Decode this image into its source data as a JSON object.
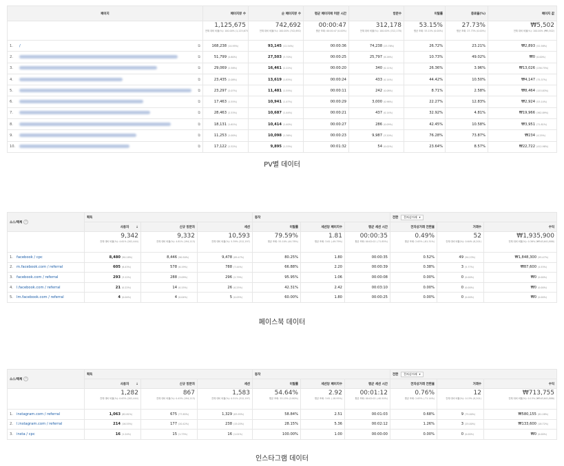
{
  "pv": {
    "caption": "PV별 데이터",
    "headers": [
      "페이지",
      "페이지뷰 수",
      "순 페이지뷰 수",
      "평균 페이지에 머문 시간",
      "방문수",
      "이탈률",
      "종료율(%)",
      "페이지 값"
    ],
    "totals": [
      {
        "big": "1,125,675",
        "sub": "전체 대비 비율(%): 100.00% (1,125,675)"
      },
      {
        "big": "742,692",
        "sub": "전체 대비 비율(%): 100.00% (742,692)"
      },
      {
        "big": "00:00:47",
        "sub": "평균 조회: 00:00:47 (0.00%)"
      },
      {
        "big": "312,178",
        "sub": "전체 대비 비율(%): 100.00% (312,178)"
      },
      {
        "big": "53.15%",
        "sub": "평균 조회: 53.15% (0.00%)"
      },
      {
        "big": "27.73%",
        "sub": "평균 조회: 27.73% (0.00%)"
      },
      {
        "big": "₩5,502",
        "sub": "전체 대비 비율(%): 100.00% (₩5,502)"
      }
    ],
    "rows": [
      {
        "n": "1.",
        "page": "/",
        "pv": "168,238",
        "pvp": "(14.95%)",
        "upv": "93,145",
        "upvp": "(12.54%)",
        "time": "00:00:36",
        "ent": "74,238",
        "entp": "(23.78%)",
        "bounce": "26.72%",
        "exit": "23.21%",
        "val": "₩2,893",
        "valp": "(52.58%)"
      },
      {
        "n": "2.",
        "page": "",
        "pv": "51,799",
        "pvp": "(4.60%)",
        "upv": "27,503",
        "upvp": "(3.70%)",
        "time": "00:00:25",
        "ent": "25,797",
        "entp": "(8.26%)",
        "bounce": "10.73%",
        "exit": "49.02%",
        "val": "₩0",
        "valp": "(0.00%)"
      },
      {
        "n": "3.",
        "page": "",
        "pv": "29,069",
        "pvp": "(2.58%)",
        "upv": "16,461",
        "upvp": "(2.22%)",
        "time": "00:00:20",
        "ent": "340",
        "entp": "(0.11%)",
        "bounce": "26.36%",
        "exit": "3.96%",
        "val": "₩13,026",
        "valp": "(236.75%)"
      },
      {
        "n": "4.",
        "page": "",
        "pv": "23,435",
        "pvp": "(2.08%)",
        "upv": "13,619",
        "upvp": "(1.83%)",
        "time": "00:00:24",
        "ent": "433",
        "entp": "(0.14%)",
        "bounce": "44.42%",
        "exit": "10.50%",
        "val": "₩4,147",
        "valp": "(75.37%)"
      },
      {
        "n": "5.",
        "page": "",
        "pv": "23,297",
        "pvp": "(2.07%)",
        "upv": "11,481",
        "upvp": "(1.55%)",
        "time": "00:00:11",
        "ent": "242",
        "entp": "(0.08%)",
        "bounce": "8.71%",
        "exit": "2.58%",
        "val": "₩8,464",
        "valp": "(153.83%)"
      },
      {
        "n": "6.",
        "page": "",
        "pv": "17,463",
        "pvp": "(1.55%)",
        "upv": "10,941",
        "upvp": "(1.47%)",
        "time": "00:00:29",
        "ent": "3,000",
        "entp": "(0.96%)",
        "bounce": "22.27%",
        "exit": "12.83%",
        "val": "₩2,924",
        "valp": "(53.14%)"
      },
      {
        "n": "7.",
        "page": "",
        "pv": "28,463",
        "pvp": "(2.53%)",
        "upv": "10,687",
        "upvp": "(1.44%)",
        "time": "00:00:21",
        "ent": "437",
        "entp": "(0.14%)",
        "bounce": "32.92%",
        "exit": "4.81%",
        "val": "₩19,966",
        "valp": "(362.89%)"
      },
      {
        "n": "8.",
        "page": "",
        "pv": "18,131",
        "pvp": "(1.61%)",
        "upv": "10,414",
        "upvp": "(1.40%)",
        "time": "00:00:27",
        "ent": "286",
        "entp": "(0.09%)",
        "bounce": "42.45%",
        "exit": "10.58%",
        "val": "₩3,951",
        "valp": "(71.81%)"
      },
      {
        "n": "9.",
        "page": "",
        "pv": "11,253",
        "pvp": "(1.00%)",
        "upv": "10,098",
        "upvp": "(1.36%)",
        "time": "00:00:23",
        "ent": "9,987",
        "entp": "(3.20%)",
        "bounce": "76.28%",
        "exit": "73.87%",
        "val": "₩234",
        "valp": "(4.25%)"
      },
      {
        "n": "10.",
        "page": "",
        "pv": "17,122",
        "pvp": "(1.52%)",
        "upv": "9,895",
        "upvp": "(1.33%)",
        "time": "00:01:32",
        "ent": "54",
        "entp": "(0.02%)",
        "bounce": "23.64%",
        "exit": "8.57%",
        "val": "₩22,722",
        "valp": "(412.98%)"
      }
    ]
  },
  "fb": {
    "caption": "페이스북 데이터",
    "source_header": "소스/매체",
    "group_acq": "획득",
    "group_beh": "동작",
    "group_conv": "전환",
    "conv_select": "전자상거래",
    "headers": [
      "사용자",
      "신규 방문자",
      "세션",
      "이탈률",
      "세션당 페이지수",
      "평균 세션 시간",
      "전자상거래 전환율",
      "거래수",
      "수익"
    ],
    "totals": [
      {
        "big": "9,342",
        "sub": "전체 대비 비율(%): 4.61% (202,444)"
      },
      {
        "big": "9,332",
        "sub": "전체 대비 비율(%): 4.81% (194,113)"
      },
      {
        "big": "10,593",
        "sub": "전체 대비 비율(%): 5.39% (312,197)"
      },
      {
        "big": "79.59%",
        "sub": "평균 조회: 55.10% (44.78%)"
      },
      {
        "big": "1.81",
        "sub": "평균 조회: 3.61 (-49.79%)"
      },
      {
        "big": "00:00:35",
        "sub": "평균 조회: 00:02:02 (-71.85%)"
      },
      {
        "big": "0.49%",
        "sub": "평균 조회: 2.63% (-81.31%)"
      },
      {
        "big": "52",
        "sub": "전체 대비 비율(%): 0.64% (8,201)"
      },
      {
        "big": "₩1,935,900",
        "sub": "전체 대비 비율(%): 0.36% (₩543,641,888)"
      }
    ],
    "rows": [
      {
        "n": "1.",
        "src": "facebook / cpc",
        "u": "8,480",
        "up": "(90.18%)",
        "nu": "8,446",
        "nup": "(90.50%)",
        "s": "9,478",
        "sp": "(89.47%)",
        "b": "80.25%",
        "pps": "1.80",
        "t": "00:00:35",
        "cr": "0.52%",
        "tx": "49",
        "txp": "(94.23%)",
        "rev": "₩1,848,300",
        "revp": "(95.47%)"
      },
      {
        "n": "2.",
        "src": "m.facebook.com / referral",
        "u": "605",
        "up": "(6.43%)",
        "nu": "578",
        "nup": "(6.19%)",
        "s": "788",
        "sp": "(7.44%)",
        "b": "66.88%",
        "pps": "2.20",
        "t": "00:00:39",
        "cr": "0.38%",
        "tx": "3",
        "txp": "(5.77%)",
        "rev": "₩87,600",
        "revp": "(4.53%)"
      },
      {
        "n": "3.",
        "src": "facebook.com / referral",
        "u": "293",
        "up": "(3.12%)",
        "nu": "288",
        "nup": "(3.09%)",
        "s": "296",
        "sp": "(2.79%)",
        "b": "95.95%",
        "pps": "1.06",
        "t": "00:00:08",
        "cr": "0.00%",
        "tx": "0",
        "txp": "(0.00%)",
        "rev": "₩0",
        "revp": "(0.00%)"
      },
      {
        "n": "4.",
        "src": "l.facebook.com / referral",
        "u": "21",
        "up": "(0.22%)",
        "nu": "14",
        "nup": "(0.15%)",
        "s": "26",
        "sp": "(0.25%)",
        "b": "42.31%",
        "pps": "2.42",
        "t": "00:03:10",
        "cr": "0.00%",
        "tx": "0",
        "txp": "(0.00%)",
        "rev": "₩0",
        "revp": "(0.00%)"
      },
      {
        "n": "5.",
        "src": "lm.facebook.com / referral",
        "u": "4",
        "up": "(0.04%)",
        "nu": "4",
        "nup": "(0.04%)",
        "s": "5",
        "sp": "(0.05%)",
        "b": "60.00%",
        "pps": "1.80",
        "t": "00:00:25",
        "cr": "0.00%",
        "tx": "0",
        "txp": "(0.00%)",
        "rev": "₩0",
        "revp": "(0.00%)"
      }
    ]
  },
  "ig": {
    "caption": "인스타그램 데이터",
    "source_header": "소스/매체",
    "group_acq": "획득",
    "group_beh": "동작",
    "group_conv": "전환",
    "conv_select": "전자상거래",
    "headers": [
      "사용자",
      "신규 방문자",
      "세션",
      "이탈률",
      "세션당 페이지수",
      "평균 세션 시간",
      "전자상거래 전환율",
      "거래수",
      "수익"
    ],
    "totals": [
      {
        "big": "1,282",
        "sub": "전체 대비 비율(%): 0.63% (202,444)"
      },
      {
        "big": "867",
        "sub": "전체 대비 비율(%): 0.45% (194,113)"
      },
      {
        "big": "1,583",
        "sub": "전체 대비 비율(%): 0.51% (312,197)"
      },
      {
        "big": "54.64%",
        "sub": "평균 조회: 53.15% (2.80%)"
      },
      {
        "big": "2.92",
        "sub": "평균 조회: 3.61 (-18.95%)"
      },
      {
        "big": "00:01:12",
        "sub": "평균 조회: 00:02:02 (-40.50%)"
      },
      {
        "big": "0.76%",
        "sub": "평균 조회: 2.63% (-71.14%)"
      },
      {
        "big": "12",
        "sub": "전체 대비 비율(%): 0.15% (8,201)"
      },
      {
        "big": "₩713,755",
        "sub": "전체 대비 비율(%): 0.13% (₩543,641,888)"
      }
    ],
    "rows": [
      {
        "n": "1.",
        "src": "instagram.com / referral",
        "u": "1,063",
        "up": "(82.81%)",
        "nu": "675",
        "nup": "(77.85%)",
        "s": "1,329",
        "sp": "(83.95%)",
        "b": "58.84%",
        "pps": "2.51",
        "t": "00:01:03",
        "cr": "0.68%",
        "tx": "9",
        "txp": "(75.00%)",
        "rev": "₩580,155",
        "revp": "(81.28%)"
      },
      {
        "n": "2.",
        "src": "l.instagram.com / referral",
        "u": "214",
        "up": "(16.55%)",
        "nu": "177",
        "nup": "(20.42%)",
        "s": "238",
        "sp": "(15.03%)",
        "b": "28.15%",
        "pps": "5.36",
        "t": "00:02:12",
        "cr": "1.26%",
        "tx": "3",
        "txp": "(25.00%)",
        "rev": "₩133,600",
        "revp": "(18.72%)"
      },
      {
        "n": "3.",
        "src": "insta / cpc",
        "u": "16",
        "up": "(1.24%)",
        "nu": "15",
        "nup": "(1.73%)",
        "s": "16",
        "sp": "(1.01%)",
        "b": "100.00%",
        "pps": "1.00",
        "t": "00:00:00",
        "cr": "0.00%",
        "tx": "0",
        "txp": "(0.00%)",
        "rev": "₩0",
        "revp": "(0.00%)"
      }
    ]
  }
}
